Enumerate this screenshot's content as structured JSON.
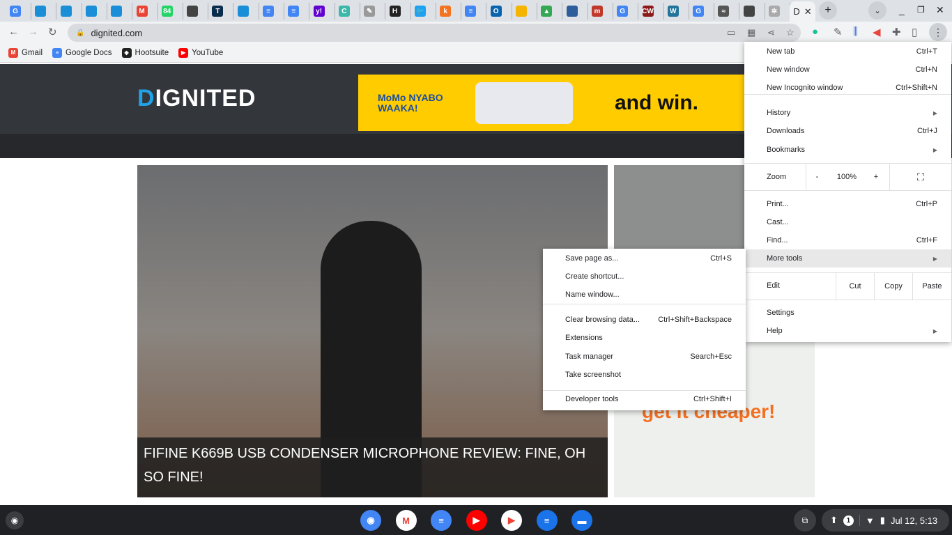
{
  "tabs": [
    {
      "icon": "google-icon",
      "letter": "G",
      "color": "#4285f4"
    },
    {
      "icon": "doc-icon",
      "letter": "",
      "color": "#1a8fd8"
    },
    {
      "icon": "doc-icon",
      "letter": "",
      "color": "#1a8fd8"
    },
    {
      "icon": "doc-icon",
      "letter": "",
      "color": "#1a8fd8"
    },
    {
      "icon": "doc-icon",
      "letter": "",
      "color": "#1a8fd8"
    },
    {
      "icon": "gmail-icon",
      "letter": "M",
      "color": "#ea4335"
    },
    {
      "icon": "whatsapp-icon",
      "letter": "84",
      "color": "#25d366"
    },
    {
      "icon": "site-icon",
      "letter": "",
      "color": "#444"
    },
    {
      "icon": "techcrunch-icon",
      "letter": "T",
      "color": "#0a2d4c"
    },
    {
      "icon": "doc-icon",
      "letter": "",
      "color": "#1a8fd8"
    },
    {
      "icon": "google-docs-icon",
      "letter": "≡",
      "color": "#4285f4"
    },
    {
      "icon": "google-docs-icon",
      "letter": "≡",
      "color": "#4285f4"
    },
    {
      "icon": "yahoo-icon",
      "letter": "y!",
      "color": "#6001d2"
    },
    {
      "icon": "c-icon",
      "letter": "C",
      "color": "#3bb8a9"
    },
    {
      "icon": "feather-icon",
      "letter": "✎",
      "color": "#999"
    },
    {
      "icon": "h-icon",
      "letter": "H",
      "color": "#222"
    },
    {
      "icon": "twitter-icon",
      "letter": "🐦",
      "color": "#1da1f2"
    },
    {
      "icon": "k-icon",
      "letter": "k",
      "color": "#f47321"
    },
    {
      "icon": "google-docs-icon",
      "letter": "≡",
      "color": "#4285f4"
    },
    {
      "icon": "outlook-icon",
      "letter": "O",
      "color": "#0a64ad"
    },
    {
      "icon": "slides-icon",
      "letter": "",
      "color": "#f4b400"
    },
    {
      "icon": "drive-icon",
      "letter": "▲",
      "color": "#34a853"
    },
    {
      "icon": "shield-icon",
      "letter": "",
      "color": "#2d5d9a"
    },
    {
      "icon": "m-icon",
      "letter": "m",
      "color": "#c0392b"
    },
    {
      "icon": "google-icon",
      "letter": "G",
      "color": "#4285f4"
    },
    {
      "icon": "cw-icon",
      "letter": "CW",
      "color": "#8b1a1a"
    },
    {
      "icon": "wordpress-icon",
      "letter": "W",
      "color": "#21759b"
    },
    {
      "icon": "google-icon",
      "letter": "G",
      "color": "#4285f4"
    },
    {
      "icon": "flag-icon",
      "letter": "≈",
      "color": "#555"
    },
    {
      "icon": "site-icon",
      "letter": "",
      "color": "#444"
    },
    {
      "icon": "openai-icon",
      "letter": "✲",
      "color": "#aaa"
    }
  ],
  "active_tab": {
    "title": "D"
  },
  "address": {
    "url": "dignited.com"
  },
  "bookmarks": [
    {
      "label": "Gmail",
      "icon": "gmail-icon",
      "color": "#ea4335",
      "letter": "M"
    },
    {
      "label": "Google Docs",
      "icon": "google-docs-icon",
      "color": "#4285f4",
      "letter": "≡"
    },
    {
      "label": "Hootsuite",
      "icon": "hootsuite-icon",
      "color": "#222",
      "letter": "◆"
    },
    {
      "label": "YouTube",
      "icon": "youtube-icon",
      "color": "#ff0000",
      "letter": "▶"
    }
  ],
  "site": {
    "logo": "DIGNITED",
    "ad_text": "and win.",
    "ad_brand": "MoMo NYABO WAAKA!",
    "article_title": "FIFINE K669B USB CONDENSER MICROPHONE REVIEW: FINE, OH SO FINE!",
    "side_ad_text": "get it cheaper!"
  },
  "main_menu": {
    "items": [
      {
        "label": "New tab",
        "shortcut": "Ctrl+T"
      },
      {
        "label": "New window",
        "shortcut": "Ctrl+N"
      },
      {
        "label": "New Incognito window",
        "shortcut": "Ctrl+Shift+N"
      },
      {
        "label": "History",
        "submenu": true
      },
      {
        "label": "Downloads",
        "shortcut": "Ctrl+J"
      },
      {
        "label": "Bookmarks",
        "submenu": true
      },
      {
        "label": "Print...",
        "shortcut": "Ctrl+P"
      },
      {
        "label": "Cast..."
      },
      {
        "label": "Find...",
        "shortcut": "Ctrl+F"
      },
      {
        "label": "More tools",
        "submenu": true,
        "highlighted": true
      },
      {
        "label": "Settings"
      },
      {
        "label": "Help",
        "submenu": true
      }
    ],
    "zoom": {
      "label": "Zoom",
      "minus": "-",
      "value": "100%",
      "plus": "+"
    },
    "edit": {
      "label": "Edit",
      "cut": "Cut",
      "copy": "Copy",
      "paste": "Paste"
    }
  },
  "more_tools": [
    {
      "label": "Save page as...",
      "shortcut": "Ctrl+S"
    },
    {
      "label": "Create shortcut..."
    },
    {
      "label": "Name window..."
    },
    {
      "label": "Clear browsing data...",
      "shortcut": "Ctrl+Shift+Backspace"
    },
    {
      "label": "Extensions"
    },
    {
      "label": "Task manager",
      "shortcut": "Search+Esc"
    },
    {
      "label": "Take screenshot"
    },
    {
      "label": "Developer tools",
      "shortcut": "Ctrl+Shift+I"
    }
  ],
  "shelf": {
    "apps": [
      {
        "name": "chrome",
        "color": "#4285f4",
        "letter": "◉"
      },
      {
        "name": "gmail",
        "color": "#fff",
        "letter": "M"
      },
      {
        "name": "google-docs",
        "color": "#4285f4",
        "letter": "≡"
      },
      {
        "name": "youtube",
        "color": "#ff0000",
        "letter": "▶"
      },
      {
        "name": "play-store",
        "color": "#fff",
        "letter": "▶"
      },
      {
        "name": "messages",
        "color": "#1a73e8",
        "letter": "≡"
      },
      {
        "name": "files",
        "color": "#1a73e8",
        "letter": "▬"
      }
    ],
    "notification_count": "1",
    "clock": "Jul 12, 5:13"
  }
}
